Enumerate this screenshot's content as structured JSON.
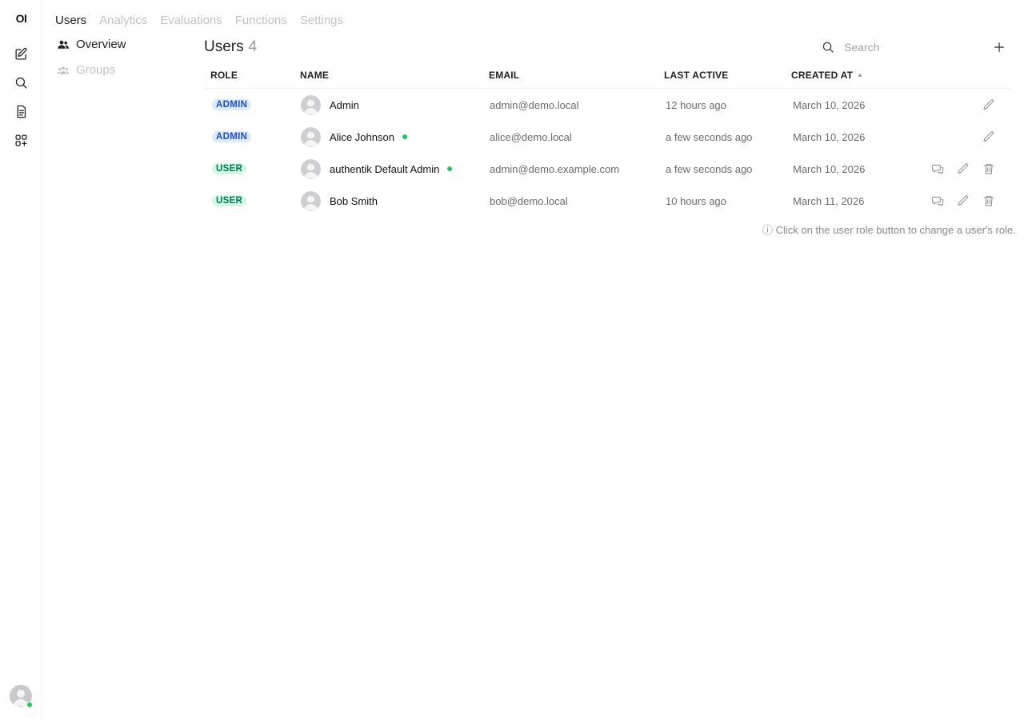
{
  "app": {
    "logo": "OI"
  },
  "tabs": [
    "Users",
    "Analytics",
    "Evaluations",
    "Functions",
    "Settings"
  ],
  "subnav": {
    "overview": "Overview",
    "groups": "Groups"
  },
  "header": {
    "title": "Users",
    "count": "4"
  },
  "search": {
    "placeholder": "Search"
  },
  "table": {
    "columns": {
      "role": "ROLE",
      "name": "NAME",
      "email": "EMAIL",
      "last_active": "LAST ACTIVE",
      "created_at": "CREATED AT"
    },
    "rows": [
      {
        "role": "ADMIN",
        "name": "Admin",
        "email": "admin@demo.local",
        "last_active": "12 hours ago",
        "created_at": "March 10, 2026",
        "online": false
      },
      {
        "role": "ADMIN",
        "name": "Alice Johnson",
        "email": "alice@demo.local",
        "last_active": "a few seconds ago",
        "created_at": "March 10, 2026",
        "online": true
      },
      {
        "role": "USER",
        "name": "authentik Default Admin",
        "email": "admin@demo.example.com",
        "last_active": "a few seconds ago",
        "created_at": "March 10, 2026",
        "online": true
      },
      {
        "role": "USER",
        "name": "Bob Smith",
        "email": "bob@demo.local",
        "last_active": "10 hours ago",
        "created_at": "March 11, 2026",
        "online": false
      }
    ]
  },
  "hint": "ⓘ Click on the user role button to change a user's role.",
  "colors": {
    "admin_badge_bg": "#dbeafe",
    "admin_badge_text": "#1d4ed8",
    "user_badge_bg": "#d1fae5",
    "user_badge_text": "#047857",
    "online": "#22c55e"
  }
}
